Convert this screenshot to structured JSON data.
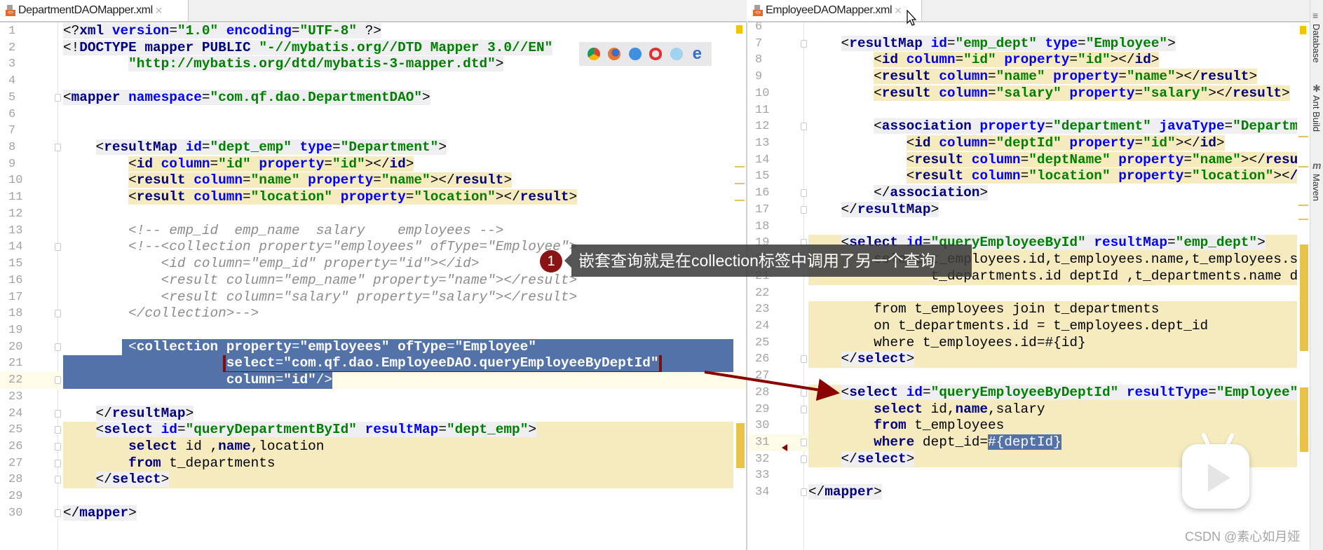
{
  "left_editor": {
    "tab_label": "DepartmentDAOMapper.xml",
    "lines": [
      {
        "n": 1,
        "kind": "xml",
        "text": "<?xml version=\"1.0\" encoding=\"UTF-8\" ?>"
      },
      {
        "n": 2,
        "kind": "xml",
        "text": "<!DOCTYPE mapper PUBLIC \"-//mybatis.org//DTD Mapper 3.0//EN\""
      },
      {
        "n": 3,
        "kind": "xml",
        "text": "        \"http://mybatis.org/dtd/mybatis-3-mapper.dtd\">"
      },
      {
        "n": 4,
        "kind": "blank",
        "text": ""
      },
      {
        "n": 5,
        "kind": "xml",
        "text": "<mapper namespace=\"com.qf.dao.DepartmentDAO\">",
        "fold": true
      },
      {
        "n": 6,
        "kind": "blank",
        "text": ""
      },
      {
        "n": 7,
        "kind": "blank",
        "text": ""
      },
      {
        "n": 8,
        "kind": "xml",
        "text": "    <resultMap id=\"dept_emp\" type=\"Department\">",
        "fold": true
      },
      {
        "n": 9,
        "kind": "xml",
        "bg": "text",
        "text": "        <id column=\"id\" property=\"id\"></id>"
      },
      {
        "n": 10,
        "kind": "xml",
        "bg": "text",
        "text": "        <result column=\"name\" property=\"name\"></result>"
      },
      {
        "n": 11,
        "kind": "xml",
        "bg": "text",
        "text": "        <result column=\"location\" property=\"location\"></result>"
      },
      {
        "n": 12,
        "kind": "blank",
        "text": ""
      },
      {
        "n": 13,
        "kind": "comment",
        "text": "        <!-- emp_id  emp_name  salary    employees -->"
      },
      {
        "n": 14,
        "kind": "comment",
        "text": "        <!--<collection property=\"employees\" ofType=\"Employee\">",
        "fold": true
      },
      {
        "n": 15,
        "kind": "comment",
        "text": "            <id column=\"emp_id\" property=\"id\"></id>"
      },
      {
        "n": 16,
        "kind": "comment",
        "text": "            <result column=\"emp_name\" property=\"name\"></result>"
      },
      {
        "n": 17,
        "kind": "comment",
        "text": "            <result column=\"salary\" property=\"salary\"></result>"
      },
      {
        "n": 18,
        "kind": "comment",
        "text": "        </collection>-->",
        "fold": true
      },
      {
        "n": 19,
        "kind": "blank",
        "text": ""
      },
      {
        "n": 20,
        "kind": "xml",
        "bg": "sel-rest",
        "text": "        <collection property=\"employees\" ofType=\"Employee\"",
        "fold": true
      },
      {
        "n": 21,
        "kind": "xml",
        "bg": "sel-full",
        "boxed": true,
        "text": "                    select=\"com.qf.dao.EmployeeDAO.queryEmployeeByDeptId\""
      },
      {
        "n": 22,
        "kind": "xml",
        "bg": "sel-text",
        "current": true,
        "text": "                    column=\"id\"/>",
        "fold": true
      },
      {
        "n": 23,
        "kind": "blank",
        "text": ""
      },
      {
        "n": 24,
        "kind": "xml",
        "text": "    </resultMap>",
        "fold": true
      },
      {
        "n": 25,
        "kind": "xml",
        "bg": "full",
        "text": "    <select id=\"queryDepartmentById\" resultMap=\"dept_emp\">",
        "fold": true
      },
      {
        "n": 26,
        "kind": "sql",
        "bg": "full",
        "kw": true,
        "text": "        select id ,name,location",
        "fold": true
      },
      {
        "n": 27,
        "kind": "sql",
        "bg": "full",
        "kw": true,
        "text": "        from t_departments",
        "fold": true
      },
      {
        "n": 28,
        "kind": "xml",
        "bg": "full",
        "text": "    </select>",
        "fold": true
      },
      {
        "n": 29,
        "kind": "blank",
        "text": ""
      },
      {
        "n": 30,
        "kind": "xml",
        "text": "</mapper>",
        "fold": true
      }
    ]
  },
  "right_editor": {
    "tab_label": "EmployeeDAOMapper.xml",
    "lines": [
      {
        "n": 6,
        "kind": "blank",
        "text": ""
      },
      {
        "n": 7,
        "kind": "xml",
        "text": "    <resultMap id=\"emp_dept\" type=\"Employee\">",
        "fold": true
      },
      {
        "n": 8,
        "kind": "xml",
        "bg": "text",
        "text": "        <id column=\"id\" property=\"id\"></id>"
      },
      {
        "n": 9,
        "kind": "xml",
        "bg": "text",
        "text": "        <result column=\"name\" property=\"name\"></result>"
      },
      {
        "n": 10,
        "kind": "xml",
        "bg": "text",
        "text": "        <result column=\"salary\" property=\"salary\"></result>"
      },
      {
        "n": 11,
        "kind": "blank",
        "text": ""
      },
      {
        "n": 12,
        "kind": "xml",
        "text": "        <association property=\"department\" javaType=\"Departm",
        "fold": true
      },
      {
        "n": 13,
        "kind": "xml",
        "bg": "text",
        "text": "            <id column=\"deptId\" property=\"id\"></id>"
      },
      {
        "n": 14,
        "kind": "xml",
        "bg": "text",
        "text": "            <result column=\"deptName\" property=\"name\"></resu"
      },
      {
        "n": 15,
        "kind": "xml",
        "bg": "text",
        "text": "            <result column=\"location\" property=\"location\"></"
      },
      {
        "n": 16,
        "kind": "xml",
        "text": "        </association>",
        "fold": true
      },
      {
        "n": 17,
        "kind": "xml",
        "text": "    </resultMap>",
        "fold": true
      },
      {
        "n": 18,
        "kind": "blank",
        "text": ""
      },
      {
        "n": 19,
        "kind": "xml",
        "bg": "full",
        "text": "    <select id=\"queryEmployeeById\" resultMap=\"emp_dept\">",
        "fold": true
      },
      {
        "n": 20,
        "kind": "sql",
        "bg": "full",
        "text": "        select t_employees.id,t_employees.name,t_employees.s"
      },
      {
        "n": 21,
        "kind": "sql",
        "bg": "full",
        "text": "               t_departments.id deptId ,t_departments.name d"
      },
      {
        "n": 22,
        "kind": "blank",
        "bg": "full",
        "text": ""
      },
      {
        "n": 23,
        "kind": "sql",
        "bg": "full",
        "text": "        from t_employees join t_departments"
      },
      {
        "n": 24,
        "kind": "sql",
        "bg": "full",
        "text": "        on t_departments.id = t_employees.dept_id"
      },
      {
        "n": 25,
        "kind": "sql",
        "bg": "full",
        "text": "        where t_employees.id=#{id}"
      },
      {
        "n": 26,
        "kind": "xml",
        "bg": "full",
        "text": "    </select>",
        "fold": true
      },
      {
        "n": 27,
        "kind": "blank",
        "text": ""
      },
      {
        "n": 28,
        "kind": "xml",
        "bg": "full",
        "text": "    <select id=\"queryEmployeeByDeptId\" resultType=\"Employee\"",
        "fold": true
      },
      {
        "n": 29,
        "kind": "sql",
        "bg": "full",
        "kw": true,
        "text": "        select id,name,salary",
        "fold": true
      },
      {
        "n": 30,
        "kind": "sql",
        "bg": "full",
        "kw": true,
        "text": "        from t_employees"
      },
      {
        "n": 31,
        "kind": "sql",
        "bg": "full",
        "kw": true,
        "current": true,
        "selected": "#{deptId}",
        "text": "        where dept_id=#{deptId}",
        "fold": true
      },
      {
        "n": 32,
        "kind": "xml",
        "bg": "full",
        "text": "    </select>",
        "fold": true
      },
      {
        "n": 33,
        "kind": "blank",
        "text": ""
      },
      {
        "n": 34,
        "kind": "xml",
        "text": "</mapper>",
        "fold": true
      }
    ]
  },
  "sql_keywords": [
    "select",
    "from",
    "where",
    "name"
  ],
  "annotation": {
    "badge": "1",
    "text": "嵌套查询就是在collection标签中调用了另一个查询",
    "color": "#8a1414"
  },
  "tool_windows": [
    {
      "label": "Database",
      "icon": "database-icon"
    },
    {
      "label": "Ant Build",
      "icon": "ant-icon"
    },
    {
      "label": "Maven",
      "icon": "maven-icon"
    }
  ],
  "browser_icons": [
    "chrome-icon",
    "firefox-icon",
    "safari-icon",
    "opera-icon",
    "ie-icon",
    "edge-icon"
  ],
  "watermark": "CSDN @素心如月娅",
  "colors": {
    "selection": "#5272a8",
    "highlight": "#f6ebbf",
    "arrow": "#8b0000",
    "tag": "#000080",
    "attribute": "#0000ff",
    "string": "#008000",
    "comment": "#8c8c8c"
  }
}
